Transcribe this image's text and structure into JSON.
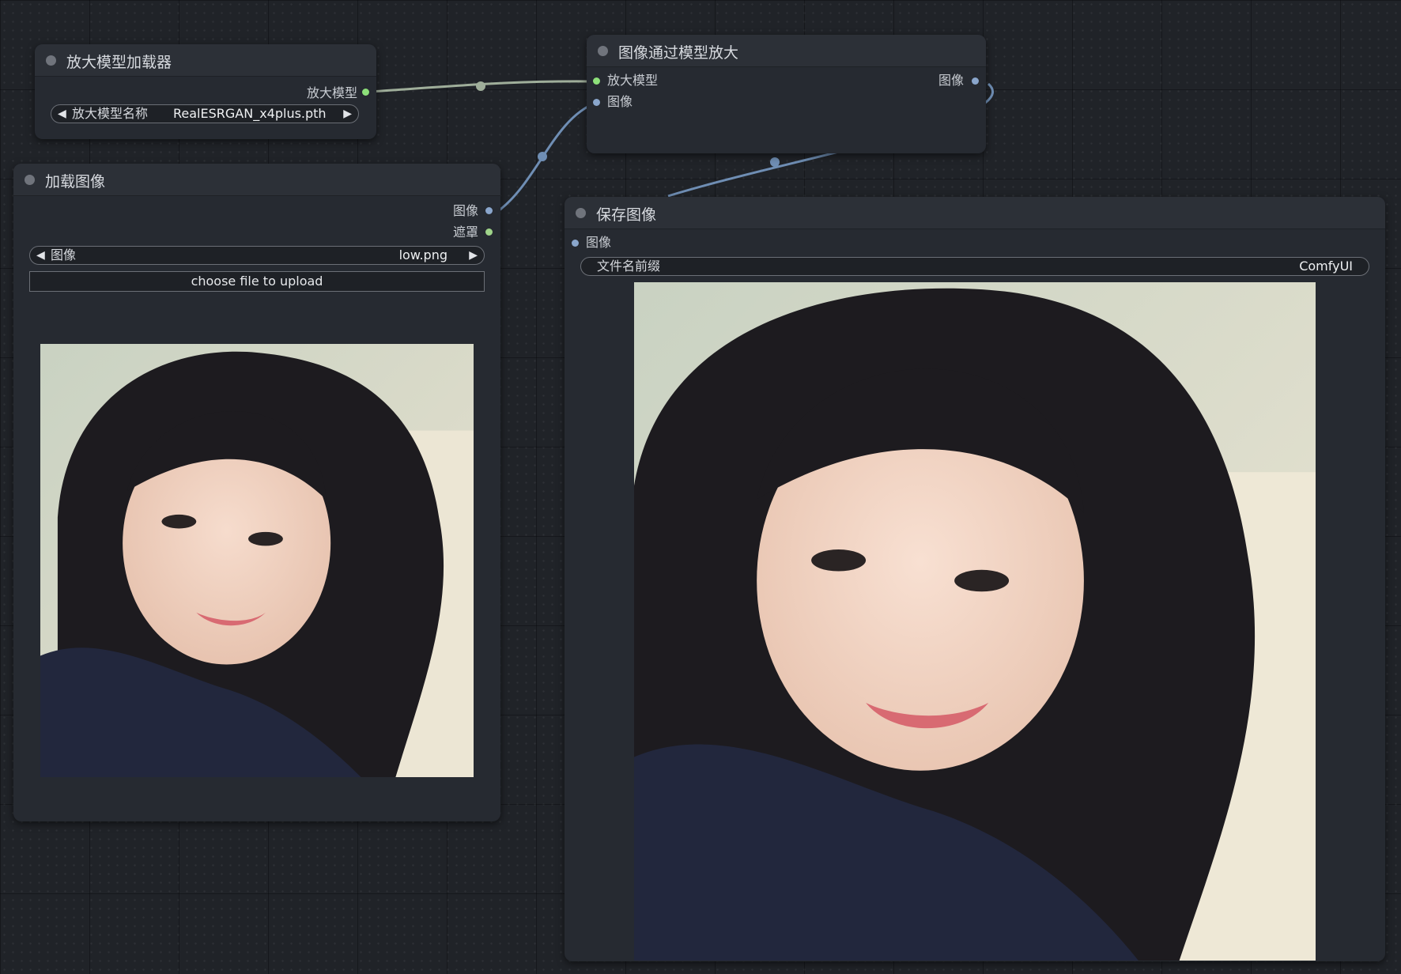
{
  "colors": {
    "canvas": "#202328",
    "node_body": "#262a31",
    "node_header": "#2c3037",
    "link_upscale_model": "#9fae9a",
    "link_image": "#6f8eb4",
    "socket_upscale_model": "#8de07a",
    "socket_image": "#8aa6cc",
    "socket_mask": "#9fd48a"
  },
  "nodes": {
    "upscale_loader": {
      "title": "放大模型加载器",
      "output_label": "放大模型",
      "widget": {
        "label": "放大模型名称",
        "value": "RealESRGAN_x4plus.pth"
      }
    },
    "load_image": {
      "title": "加载图像",
      "outputs": {
        "image": "图像",
        "mask": "遮罩"
      },
      "widget": {
        "label": "图像",
        "value": "low.png"
      },
      "upload_label": "choose file to upload"
    },
    "upscale_with_model": {
      "title": "图像通过模型放大",
      "inputs": {
        "upscale_model": "放大模型",
        "image": "图像"
      },
      "output_label": "图像"
    },
    "save_image": {
      "title": "保存图像",
      "input_label": "图像",
      "widget": {
        "label": "文件名前缀",
        "value": "ComfyUI"
      }
    }
  }
}
